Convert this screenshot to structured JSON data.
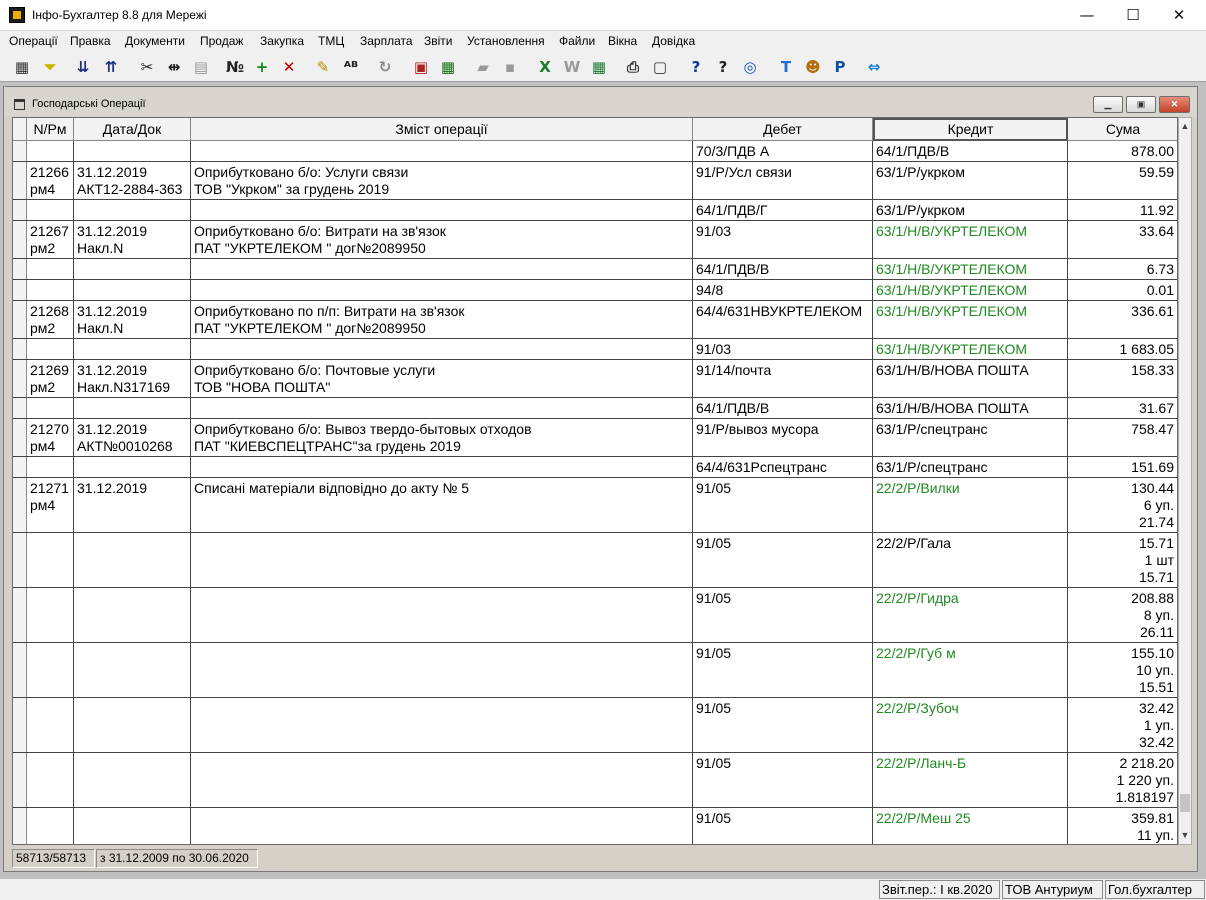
{
  "app": {
    "title": "Інфо-Бухгалтер 8.8 для Мережі"
  },
  "menu": [
    "Операції",
    "Правка",
    "Документи",
    "Продаж",
    "Закупка",
    "ТМЦ",
    "Зарплата",
    "Звіти",
    "Установлення",
    "Файли",
    "Вікна",
    "Довідка"
  ],
  "toolbar": [
    {
      "name": "doc-list-icon",
      "glyph": "▦",
      "color": "#333"
    },
    {
      "name": "filter-icon",
      "glyph": "⏷",
      "color": "#c8b400"
    },
    {
      "name": "sort-asc-icon",
      "glyph": "⇊",
      "color": "#203080"
    },
    {
      "name": "sort-desc-icon",
      "glyph": "⇈",
      "color": "#203080"
    },
    {
      "name": "cut-icon",
      "glyph": "✂",
      "color": "#222"
    },
    {
      "name": "split-icon",
      "glyph": "⇹",
      "color": "#222"
    },
    {
      "name": "paste-icon",
      "glyph": "▤",
      "color": "#999"
    },
    {
      "name": "numbering-icon",
      "glyph": "№",
      "color": "#222"
    },
    {
      "name": "add-icon",
      "glyph": "+",
      "color": "#108a10"
    },
    {
      "name": "delete-icon",
      "glyph": "✕",
      "color": "#c00000"
    },
    {
      "name": "marker-icon",
      "glyph": "✎",
      "color": "#b09000"
    },
    {
      "name": "replace-icon",
      "glyph": "ᴬᴮ",
      "color": "#222"
    },
    {
      "name": "refresh-icon",
      "glyph": "↻",
      "color": "#888"
    },
    {
      "name": "export-doc-icon",
      "glyph": "▣",
      "color": "#b02020"
    },
    {
      "name": "calculator-icon",
      "glyph": "▦",
      "color": "#107010"
    },
    {
      "name": "open-folder-icon",
      "glyph": "▰",
      "color": "#999"
    },
    {
      "name": "save-icon",
      "glyph": "▪",
      "color": "#999"
    },
    {
      "name": "excel-icon",
      "glyph": "X",
      "color": "#1a7a30"
    },
    {
      "name": "word-icon",
      "glyph": "W",
      "color": "#999"
    },
    {
      "name": "calc-export-icon",
      "glyph": "▦",
      "color": "#1a7a30"
    },
    {
      "name": "print-icon",
      "glyph": "⎙",
      "color": "#333"
    },
    {
      "name": "preview-icon",
      "glyph": "▢",
      "color": "#333"
    },
    {
      "name": "help-icon",
      "glyph": "?",
      "color": "#0a3a9a"
    },
    {
      "name": "context-help-icon",
      "glyph": "?",
      "color": "#222"
    },
    {
      "name": "compass-icon",
      "glyph": "◎",
      "color": "#1050b0"
    },
    {
      "name": "teamviewer-text-icon",
      "glyph": "T",
      "color": "#1c6fd0"
    },
    {
      "name": "users-icon",
      "glyph": "☻",
      "color": "#b07010"
    },
    {
      "name": "p-document-icon",
      "glyph": "P",
      "color": "#1050a0"
    },
    {
      "name": "teamviewer-icon",
      "glyph": "⇔",
      "color": "#0e7bd6"
    }
  ],
  "window": {
    "title": "Господарські Операції"
  },
  "columns": [
    "N/Рм",
    "Дата/Док",
    "Зміст операції",
    "Дебет",
    "Кредит",
    "Сума"
  ],
  "rows": [
    {
      "n": [],
      "date": [],
      "desc": [],
      "debit": "70/3/ПДВ А",
      "credit": "64/1/ПДВ/В",
      "credit_green": false,
      "amount": [
        "878.00"
      ]
    },
    {
      "n": [
        "21266",
        "рм4"
      ],
      "date": [
        "31.12.2019",
        "АКТ12-2884-363"
      ],
      "desc": [
        "Оприбутковано б/о: Услуги связи",
        "ТОВ \"Укрком\" за грудень 2019"
      ],
      "debit": "91/Р/Усл связи",
      "credit": "63/1/Р/укрком",
      "credit_green": false,
      "amount": [
        "59.59"
      ]
    },
    {
      "n": [],
      "date": [],
      "desc": [],
      "debit": "64/1/ПДВ/Г",
      "credit": "63/1/Р/укрком",
      "credit_green": false,
      "amount": [
        "11.92"
      ]
    },
    {
      "n": [
        "21267",
        "рм2"
      ],
      "date": [
        "31.12.2019",
        "Накл.N"
      ],
      "desc": [
        "Оприбутковано б/о: Витрати на зв'язок",
        "ПАТ \"УКРТЕЛЕКОМ \" дог№2089950"
      ],
      "debit": "91/03",
      "credit": "63/1/Н/В/УКРТЕЛЕКОМ",
      "credit_green": true,
      "amount": [
        "33.64"
      ]
    },
    {
      "n": [],
      "date": [],
      "desc": [],
      "debit": "64/1/ПДВ/В",
      "credit": "63/1/Н/В/УКРТЕЛЕКОМ",
      "credit_green": true,
      "amount": [
        "6.73"
      ]
    },
    {
      "n": [],
      "date": [],
      "desc": [],
      "debit": "94/8",
      "credit": "63/1/Н/В/УКРТЕЛЕКОМ",
      "credit_green": true,
      "amount": [
        "0.01"
      ]
    },
    {
      "n": [
        "21268",
        "рм2"
      ],
      "date": [
        "31.12.2019",
        "Накл.N"
      ],
      "desc": [
        "Оприбутковано по п/п: Витрати на зв'язок",
        "ПАТ \"УКРТЕЛЕКОМ \" дог№2089950"
      ],
      "debit": "64/4/631НВУКРТЕЛЕКОМ",
      "credit": "63/1/Н/В/УКРТЕЛЕКОМ",
      "credit_green": true,
      "amount": [
        "336.61"
      ]
    },
    {
      "n": [],
      "date": [],
      "desc": [],
      "debit": "91/03",
      "credit": "63/1/Н/В/УКРТЕЛЕКОМ",
      "credit_green": true,
      "amount": [
        "1 683.05"
      ]
    },
    {
      "n": [
        "21269",
        "рм2"
      ],
      "date": [
        "31.12.2019",
        "Накл.N317169"
      ],
      "desc": [
        "Оприбутковано б/о: Почтовые услуги",
        "ТОВ \"НОВА ПОШТА\""
      ],
      "debit": "91/14/почта",
      "credit": "63/1/Н/В/НОВА ПОШТА",
      "credit_green": false,
      "amount": [
        "158.33"
      ]
    },
    {
      "n": [],
      "date": [],
      "desc": [],
      "debit": "64/1/ПДВ/В",
      "credit": "63/1/Н/В/НОВА ПОШТА",
      "credit_green": false,
      "amount": [
        "31.67"
      ]
    },
    {
      "n": [
        "21270",
        "рм4"
      ],
      "date": [
        "31.12.2019",
        "АКТ№0010268"
      ],
      "desc": [
        "Оприбутковано б/о: Вывоз твердо-бытовых отходов",
        "ПАТ \"КИЕВСПЕЦТРАНС\"за грудень 2019"
      ],
      "debit": "91/Р/вывоз мусора",
      "credit": "63/1/Р/спецтранс",
      "credit_green": false,
      "amount": [
        "758.47"
      ]
    },
    {
      "n": [],
      "date": [],
      "desc": [],
      "debit": "64/4/631Рспецтранс",
      "credit": "63/1/Р/спецтранс",
      "credit_green": false,
      "amount": [
        "151.69"
      ]
    },
    {
      "n": [
        "21271",
        "рм4"
      ],
      "date": [
        "31.12.2019"
      ],
      "desc": [
        "Списані матеріали відповідно до акту № 5"
      ],
      "debit": "91/05",
      "credit": "22/2/Р/Вилки",
      "credit_green": true,
      "amount": [
        "130.44",
        "6 уп.",
        "21.74"
      ]
    },
    {
      "n": [],
      "date": [],
      "desc": [],
      "debit": "91/05",
      "credit": "22/2/Р/Гала",
      "credit_green": false,
      "amount": [
        "15.71",
        "1 шт",
        "15.71"
      ]
    },
    {
      "n": [],
      "date": [],
      "desc": [],
      "debit": "91/05",
      "credit": "22/2/Р/Гидра",
      "credit_green": true,
      "amount": [
        "208.88",
        "8 уп.",
        "26.11"
      ]
    },
    {
      "n": [],
      "date": [],
      "desc": [],
      "debit": "91/05",
      "credit": "22/2/Р/Губ м",
      "credit_green": true,
      "amount": [
        "155.10",
        "10 уп.",
        "15.51"
      ]
    },
    {
      "n": [],
      "date": [],
      "desc": [],
      "debit": "91/05",
      "credit": "22/2/Р/Зубоч",
      "credit_green": true,
      "amount": [
        "32.42",
        "1 уп.",
        "32.42"
      ]
    },
    {
      "n": [],
      "date": [],
      "desc": [],
      "debit": "91/05",
      "credit": "22/2/Р/Ланч-Б",
      "credit_green": true,
      "amount": [
        "2 218.20",
        "1 220 уп.",
        "1.818197"
      ]
    },
    {
      "n": [],
      "date": [],
      "desc": [],
      "debit": "91/05",
      "credit": "22/2/Р/Меш 25",
      "credit_green": true,
      "amount": [
        "359.81",
        "11 уп."
      ]
    }
  ],
  "grid_status": {
    "count": "58713/58713",
    "period": "з 31.12.2009 по 30.06.2020"
  },
  "statusbar": {
    "period": "Звіт.пер.: І кв.2020",
    "company": "ТОВ Антуриум",
    "user": "Гол.бухгалтер"
  }
}
